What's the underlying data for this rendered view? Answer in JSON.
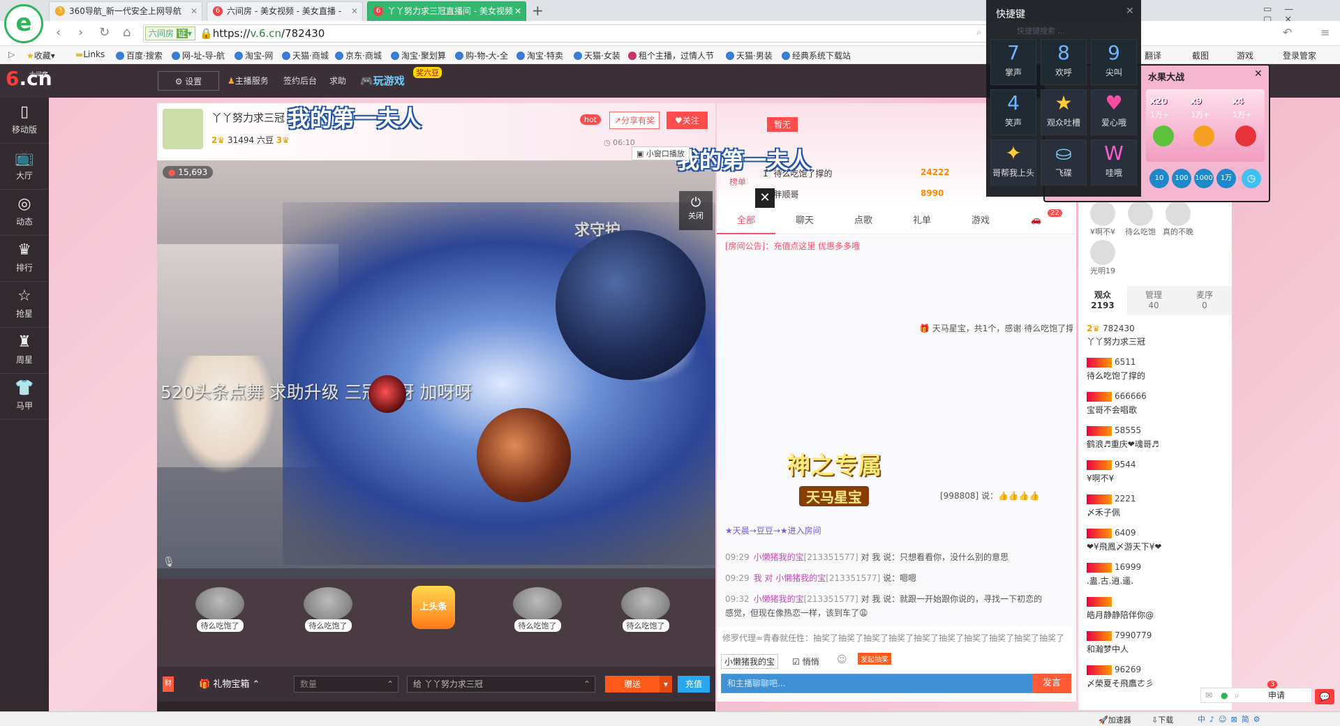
{
  "browser": {
    "tabs": [
      {
        "label": "360导航_新一代安全上网导航"
      },
      {
        "label": "六间房 - 美女视频 - 美女直播 -"
      },
      {
        "label": "丫丫努力求三冠直播间 - 美女视频"
      }
    ],
    "new_tab_glyph": "+",
    "site_tag": "六间房",
    "site_badge": "证",
    "url_scheme": "https://",
    "url_host": "v.6.cn",
    "url_path": "/782430",
    "bookmarks": [
      "收藏",
      "Links",
      "百度·搜索",
      "网-址-导-航",
      "淘宝-网",
      "天猫·商城",
      "京东·商城",
      "淘宝·聚划算",
      "购-物-大-全",
      "淘宝·特卖",
      "天猫·女装",
      "租个主播，过情人节",
      "天猫·男装",
      "经典系统下载站"
    ],
    "bookmarks_right": [
      "翻译",
      "截图",
      "游戏",
      "登录管家"
    ]
  },
  "site": {
    "logo_brand": "6",
    "logo_domain": ".cn",
    "logo_sub": "六间房",
    "header": {
      "settings": "设置",
      "anchor_service": "主播服务",
      "sign_backend": "签约后台",
      "help": "求助",
      "play_game": "玩游戏",
      "game_badge": "奖六豆"
    },
    "left_nav": [
      {
        "icon": "mobile-icon",
        "label": "移动版"
      },
      {
        "icon": "tv-icon",
        "label": "大厅"
      },
      {
        "icon": "compass-icon",
        "label": "动态"
      },
      {
        "icon": "crown-icon",
        "label": "排行"
      },
      {
        "icon": "star-icon",
        "label": "抢星"
      },
      {
        "icon": "cup-icon",
        "label": "周星"
      },
      {
        "icon": "shirt-icon",
        "label": "马甲"
      }
    ]
  },
  "anchor": {
    "name": "丫丫努力求三冠",
    "level": "2",
    "beans": "31494 六豆",
    "crowns": "3",
    "hot": "hot",
    "share": "分享有奖",
    "follow": "关注",
    "time": "06:10",
    "mini_window": "小窗口播放",
    "caption": "我的第一夫人"
  },
  "video": {
    "viewers": "15,693",
    "ticker": "520头条点舞  求助升级  三冠呀呀  加呀呀",
    "close": "关闭",
    "guard": "求守护",
    "effect_title": "神之专属",
    "effect_sub": "天马星宝"
  },
  "gift_row": {
    "items": [
      "待么吃饱了",
      "待么吃饱了",
      "上头条",
      "待么吃饱了",
      "待么吃饱了"
    ]
  },
  "controls": {
    "gift_box": "礼物宝箱",
    "qty_placeholder": "数量",
    "to_label": "给 丫丫努力求三冠",
    "give": "赠送",
    "recharge": "充值"
  },
  "chat": {
    "top_badge": "暂无",
    "rank_title": "榜单",
    "rank": [
      {
        "pos": "1",
        "name": "待么吃饱了撑的",
        "score": "24222"
      },
      {
        "pos": "2",
        "name": "胖顺哥",
        "score": "8990"
      }
    ],
    "tabs": [
      "全部",
      "聊天",
      "点歌",
      "礼单",
      "游戏"
    ],
    "car_count": "22",
    "notice": "[房间公告]：充值点这里 优惠多多哦",
    "gift_msg": "天马星宝，共1个，感谢 待么吃饱了撑",
    "thumbs_msg": "[998808] 说：👍👍👍👍",
    "enter_msg": "★天晨→豆豆→★进入房间",
    "messages": [
      {
        "time": "09:29",
        "name": "小懒猪我的宝",
        "id": "[213351577]",
        "text": "对 我 说：只想看看你，没什么别的意思"
      },
      {
        "time": "09:29",
        "name": "我 对 小懒猪我的宝",
        "id": "[213351577]",
        "text": "说：嗯嗯"
      },
      {
        "time": "09:32",
        "name": "小懒猪我的宝",
        "id": "[213351577]",
        "text": "对 我 说：就跟一开始跟你说的，寻找一下初恋的"
      },
      {
        "time": "",
        "name": "",
        "id": "",
        "text": "感觉，但现在像热恋一样，该到车了😩"
      }
    ],
    "lottery": "修罗代理≈青春就任性：抽奖了抽奖了抽奖了抽奖了抽奖了抽奖了抽奖了抽奖了抽奖了抽奖了",
    "target": "小懒猪我的宝",
    "whisper": "悄悄",
    "lottery_btn": "发起抽奖",
    "input_placeholder": "和主播聊聊吧...",
    "send": "发言"
  },
  "audience": {
    "mini_avatars": [
      "¥啊不¥",
      "待么吃饱",
      "真的不晚",
      "光明19"
    ],
    "tabs": [
      {
        "label": "观众",
        "count": "2193"
      },
      {
        "label": "管理",
        "count": "40"
      },
      {
        "label": "麦序",
        "count": "0"
      }
    ],
    "list": [
      {
        "id": "782430",
        "name": "丫丫努力求三冠"
      },
      {
        "id": "6511",
        "name": "待么吃饱了撑的"
      },
      {
        "id": "666666",
        "name": "宝哥不会唱歌"
      },
      {
        "id": "58555",
        "name": "鹤浪♬重庆❤魂哥♬"
      },
      {
        "id": "9544",
        "name": "¥啊不¥"
      },
      {
        "id": "2221",
        "name": "〆禾子佩"
      },
      {
        "id": "6409",
        "name": "❤¥飛鳳〆游天下¥❤"
      },
      {
        "id": "16999",
        "name": ".蛊.古.逍.遥."
      },
      {
        "id": "",
        "name": "皓月静静陪伴你@"
      },
      {
        "id": "7990779",
        "name": "和瀚梦中人"
      },
      {
        "id": "96269",
        "name": "〆榮夏そ飛鷹ㄜ彡"
      }
    ],
    "apply": "申请",
    "msg_count": "3"
  },
  "shortcuts": {
    "title": "快捷键",
    "search_placeholder": "快捷键搜索 ...",
    "keys": [
      {
        "num": "7",
        "label": "掌声"
      },
      {
        "num": "8",
        "label": "欢呼"
      },
      {
        "num": "9",
        "label": "尖叫"
      },
      {
        "num": "4",
        "label": "笑声"
      },
      {
        "num": "",
        "label": "观众吐槽"
      },
      {
        "num": "",
        "label": "爱心哦"
      },
      {
        "num": "",
        "label": "哥帮我上头"
      },
      {
        "num": "",
        "label": "飞碟"
      },
      {
        "num": "",
        "label": "哇哦"
      }
    ]
  },
  "fruit_game": {
    "title": "水果大战",
    "mults": [
      "x20",
      "x9",
      "x4"
    ],
    "bets": [
      "1万+",
      "1万+",
      "1万+"
    ],
    "chips": [
      "10",
      "100",
      "1000",
      "1万"
    ]
  },
  "statusbar": {
    "accelerate": "加速器",
    "download": "下载"
  }
}
